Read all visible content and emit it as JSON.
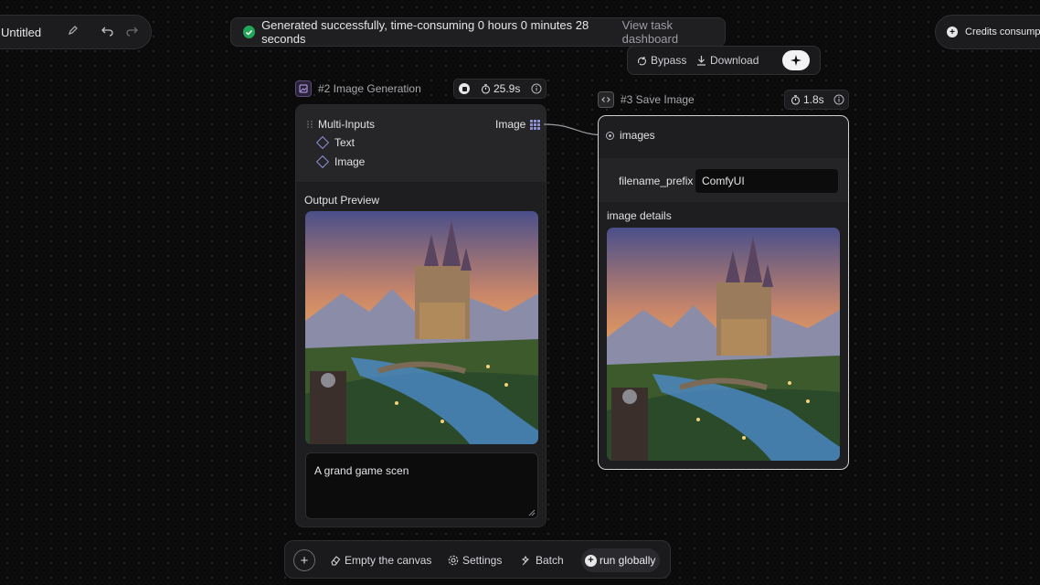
{
  "topbar": {
    "doc_title": "Untitled",
    "toast_message": "Generated successfully, time-consuming 0 hours 0 minutes 28 seconds",
    "toast_link": "View task dashboard",
    "credits_label": "Credits consumption"
  },
  "node_toolbar": {
    "bypass_label": "Bypass",
    "download_label": "Download"
  },
  "node2": {
    "title": "#2 Image Generation",
    "time": "25.9s",
    "inputs_label": "Multi-Inputs",
    "output_label": "Image",
    "input_text": "Text",
    "input_image": "Image",
    "preview_label": "Output Preview",
    "prompt": "A grand game scen"
  },
  "node3": {
    "title": "#3 Save Image",
    "time": "1.8s",
    "images_label": "images",
    "filename_label": "filename_prefix",
    "filename_value": "ComfyUI",
    "details_label": "image details"
  },
  "bottombar": {
    "empty_label": "Empty the canvas",
    "settings_label": "Settings",
    "batch_label": "Batch",
    "run_label": "run globally"
  },
  "colors": {
    "accent_success": "#23a55a",
    "selected_border": "#cfcfd4",
    "node_bg": "#1e1e21"
  },
  "icons": [
    "edit-icon",
    "undo-icon",
    "redo-icon",
    "check-circle-icon",
    "plus-circle-icon",
    "bypass-icon",
    "download-icon",
    "sparkle-icon",
    "image-node-icon",
    "code-node-icon",
    "stopwatch-icon",
    "info-icon",
    "grid-port-icon",
    "eraser-icon",
    "gear-icon",
    "batch-icon"
  ]
}
